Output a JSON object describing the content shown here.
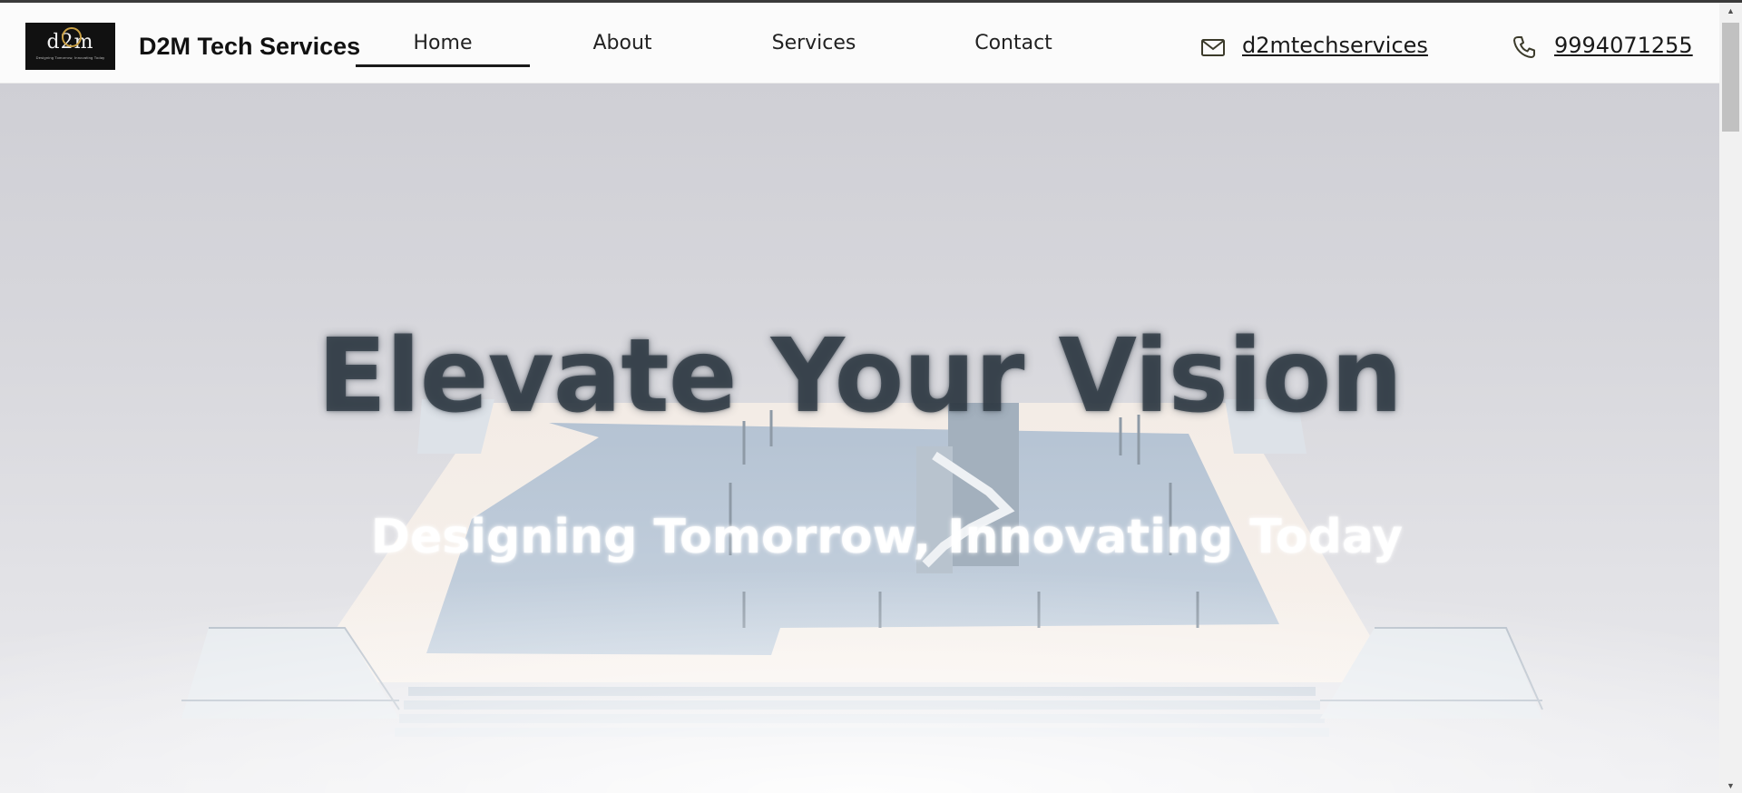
{
  "header": {
    "brand": "D2M Tech Services",
    "logo": {
      "mark": "d2m",
      "tagline": "Designing Tomorrow, Innovating Today"
    },
    "nav": [
      {
        "label": "Home",
        "active": true
      },
      {
        "label": "About",
        "active": false
      },
      {
        "label": "Services",
        "active": false
      },
      {
        "label": "Contact",
        "active": false
      }
    ],
    "email": {
      "icon": "mail-icon",
      "label": "d2mtechservices"
    },
    "phone": {
      "icon": "phone-icon",
      "label": "9994071255"
    }
  },
  "hero": {
    "title": "Elevate Your Vision",
    "subtitle": "Designing Tomorrow, Innovating Today"
  },
  "colors": {
    "header_bg": "#fbfbfb",
    "nav_underline": "#1a1a1a",
    "logo_bg": "#111111",
    "logo_accent": "#c9a044",
    "hero_bg": "#d7d7dc",
    "hero_title": "#303a44"
  }
}
